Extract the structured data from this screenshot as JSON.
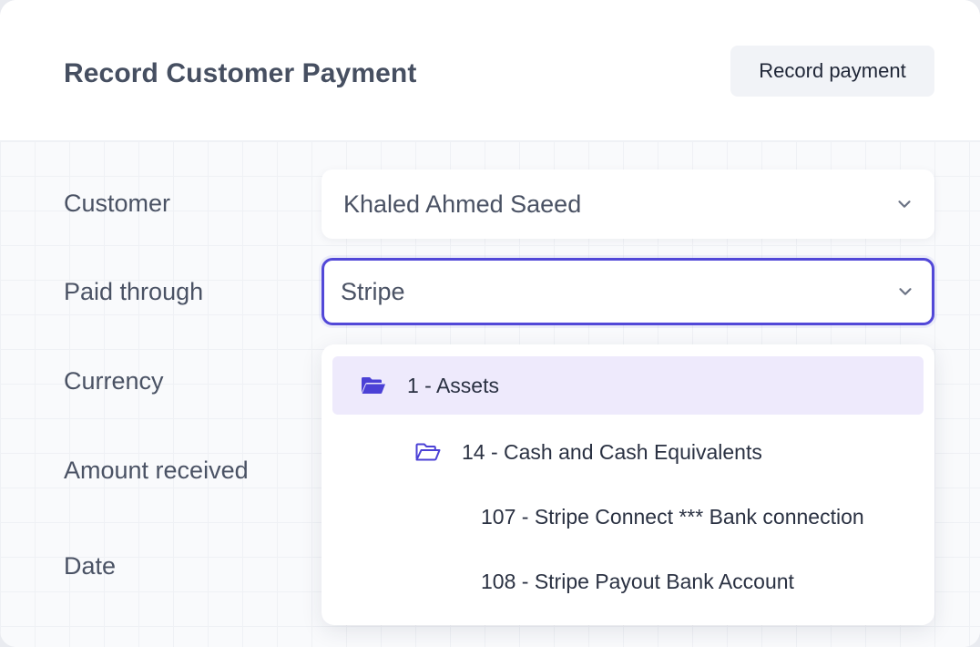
{
  "header": {
    "title": "Record Customer Payment",
    "record_button": "Record payment"
  },
  "form": {
    "customer": {
      "label": "Customer",
      "value": "Khaled Ahmed Saeed"
    },
    "paid_through": {
      "label": "Paid through",
      "value": "Stripe"
    },
    "currency": {
      "label": "Currency"
    },
    "amount": {
      "label": "Amount received"
    },
    "date": {
      "label": "Date"
    }
  },
  "dropdown": {
    "options": [
      {
        "label": "1 - Assets",
        "level": 0,
        "icon": "folder-open-filled-icon",
        "highlighted": true
      },
      {
        "label": "14 - Cash and Cash Equivalents",
        "level": 1,
        "icon": "folder-open-outline-icon",
        "highlighted": false
      },
      {
        "label": "107 - Stripe Connect *** Bank connection",
        "level": 2,
        "highlighted": false
      },
      {
        "label": "108 - Stripe Payout Bank Account",
        "level": 2,
        "highlighted": false
      }
    ]
  },
  "colors": {
    "accent": "#5248d8",
    "highlight": "#eeeafc",
    "text": "#4a5264"
  }
}
